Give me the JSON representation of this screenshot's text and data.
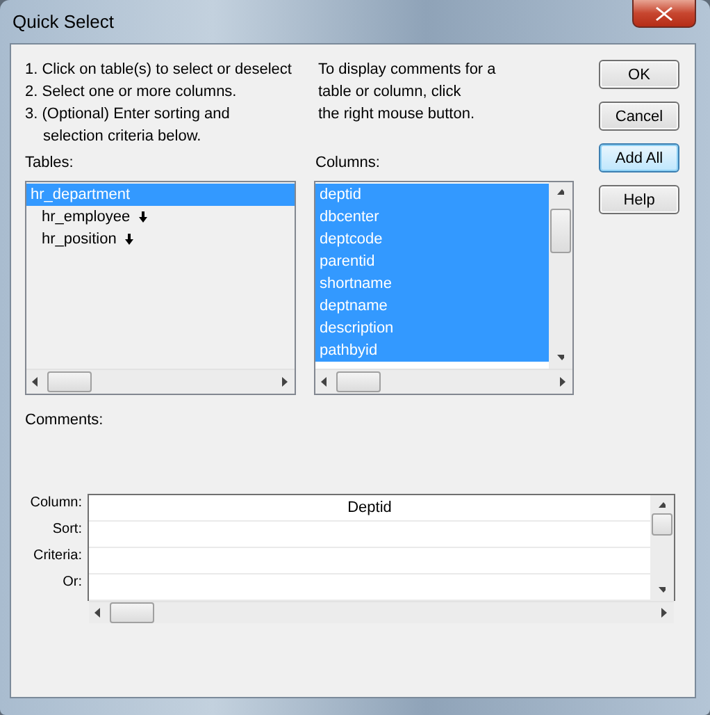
{
  "window": {
    "title": "Quick Select"
  },
  "instructions": [
    "1. Click on table(s) to select or deselect",
    "2. Select one or more columns.",
    "3. (Optional) Enter sorting and",
    "selection criteria below."
  ],
  "hint": [
    "To display comments for a",
    "table or column, click",
    "the right mouse button."
  ],
  "buttons": [
    {
      "label": "OK",
      "focused": false
    },
    {
      "label": "Cancel",
      "focused": false
    },
    {
      "label": "Add All",
      "focused": true
    },
    {
      "label": "Help",
      "focused": false
    }
  ],
  "tables": {
    "label": "Tables:",
    "items": [
      {
        "name": "hr_department",
        "selected": true,
        "linked": false,
        "children": [
          {
            "name": "hr_employee",
            "selected": false,
            "linked": true
          },
          {
            "name": "hr_position",
            "selected": false,
            "linked": true
          }
        ]
      }
    ]
  },
  "columns": {
    "label": "Columns:",
    "items": [
      {
        "name": "deptid",
        "selected": true
      },
      {
        "name": "dbcenter",
        "selected": true
      },
      {
        "name": "deptcode",
        "selected": true
      },
      {
        "name": "parentid",
        "selected": true
      },
      {
        "name": "shortname",
        "selected": true
      },
      {
        "name": "deptname",
        "selected": true
      },
      {
        "name": "description",
        "selected": true
      },
      {
        "name": "pathbyid",
        "selected": true
      }
    ]
  },
  "comments": {
    "label": "Comments:"
  },
  "criteria_grid": {
    "row_labels": [
      "Column:",
      "Sort:",
      "Criteria:",
      "Or:"
    ],
    "columns": [
      "Deptid"
    ]
  }
}
